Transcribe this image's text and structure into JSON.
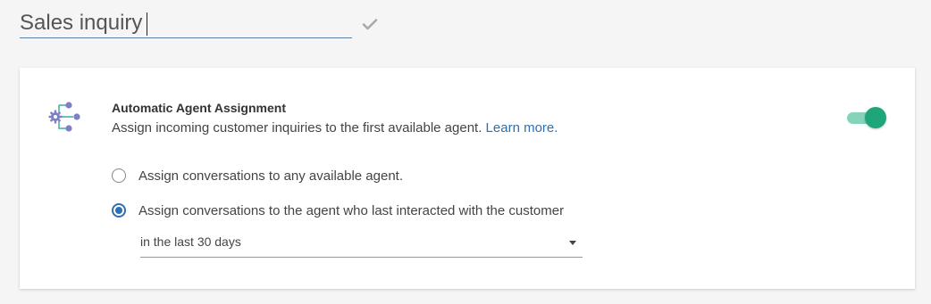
{
  "title_input": {
    "value": "Sales inquiry"
  },
  "icons": {
    "confirm": "check-icon",
    "feature": "workflow-icon"
  },
  "feature": {
    "title": "Automatic Agent Assignment",
    "description": "Assign incoming customer inquiries to the first available agent.",
    "learn_more": "Learn more.",
    "enabled": true
  },
  "options": [
    {
      "label": "Assign conversations to any available agent.",
      "selected": false
    },
    {
      "label": "Assign conversations to the agent who last interacted with the customer",
      "selected": true
    }
  ],
  "timeframe_select": {
    "value": "in the last 30 days"
  },
  "colors": {
    "accent": "#2f6faf",
    "toggle_on": "#1fa57a",
    "toggle_track": "#86d3bb",
    "icon_purple": "#7d7fc7",
    "icon_teal": "#3bb0a0"
  }
}
